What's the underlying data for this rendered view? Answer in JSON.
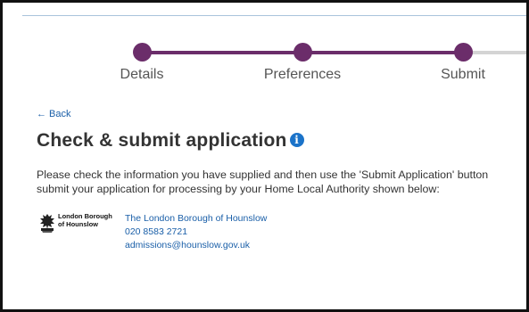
{
  "stepper": {
    "steps": [
      {
        "label": "Details"
      },
      {
        "label": "Preferences"
      },
      {
        "label": "Submit"
      }
    ]
  },
  "nav": {
    "back_label": "Back",
    "back_icon": "arrow-left-icon"
  },
  "page": {
    "title": "Check & submit application",
    "info_icon": "info-icon",
    "instructions_line1": "Please check the information you have supplied and then use the 'Submit Application' button",
    "instructions_line2": "submit your application for processing by your Home Local Authority shown below:"
  },
  "authority": {
    "logo_line1": "London Borough",
    "logo_line2": "of Hounslow",
    "name": "The London Borough of Hounslow",
    "phone": "020 8583 2721",
    "email": "admissions@hounslow.gov.uk"
  },
  "colors": {
    "step_complete": "#6b2d6a",
    "step_incomplete": "#d4d4d4",
    "link": "#1a5fa8",
    "info_icon": "#1b73c9"
  }
}
